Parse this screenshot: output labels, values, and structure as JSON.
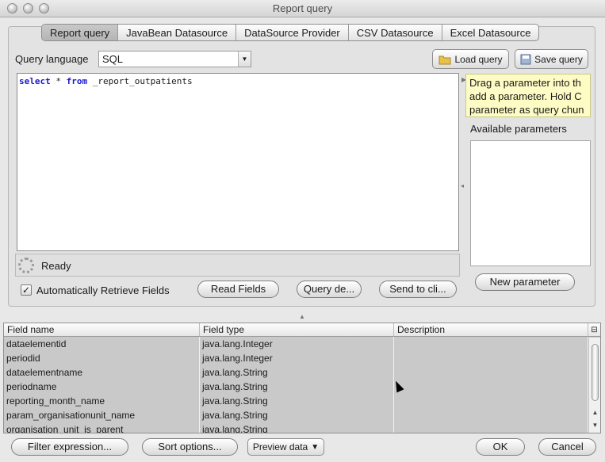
{
  "window": {
    "title": "Report query"
  },
  "tabs": [
    {
      "label": "Report query"
    },
    {
      "label": "JavaBean Datasource"
    },
    {
      "label": "DataSource Provider"
    },
    {
      "label": "CSV Datasource"
    },
    {
      "label": "Excel Datasource"
    }
  ],
  "query": {
    "language_label": "Query language",
    "language_value": "SQL",
    "load_label": "Load query",
    "save_label": "Save query",
    "sql_keyword_1": "select",
    "sql_star": " * ",
    "sql_keyword_2": "from",
    "sql_table": " _report_outpatients"
  },
  "status": {
    "text": "Ready"
  },
  "options": {
    "auto_retrieve_label": "Automatically Retrieve Fields",
    "auto_retrieve_checked": true,
    "read_fields": "Read Fields",
    "query_designer": "Query de...",
    "send_to_clipboard": "Send to cli..."
  },
  "parameters": {
    "tooltip_line1": "Drag a parameter into th",
    "tooltip_line2": "add a parameter. Hold C",
    "tooltip_line3": "parameter as query chun",
    "available_label": "Available parameters",
    "new_parameter": "New parameter"
  },
  "fields": {
    "columns": [
      "Field name",
      "Field type",
      "Description"
    ],
    "rows": [
      {
        "name": "dataelementid",
        "type": "java.lang.Integer",
        "description": ""
      },
      {
        "name": "periodid",
        "type": "java.lang.Integer",
        "description": ""
      },
      {
        "name": "dataelementname",
        "type": "java.lang.String",
        "description": ""
      },
      {
        "name": "periodname",
        "type": "java.lang.String",
        "description": ""
      },
      {
        "name": "reporting_month_name",
        "type": "java.lang.String",
        "description": ""
      },
      {
        "name": "param_organisationunit_name",
        "type": "java.lang.String",
        "description": ""
      },
      {
        "name": "organisation_unit_is_parent",
        "type": "java.lang.String",
        "description": ""
      }
    ]
  },
  "footer": {
    "filter_expression": "Filter expression...",
    "sort_options": "Sort options...",
    "preview_data": "Preview data",
    "ok": "OK",
    "cancel": "Cancel"
  },
  "icons": {
    "load": "folder-icon",
    "save": "save-disk-icon",
    "spinner": "spinner-icon"
  }
}
